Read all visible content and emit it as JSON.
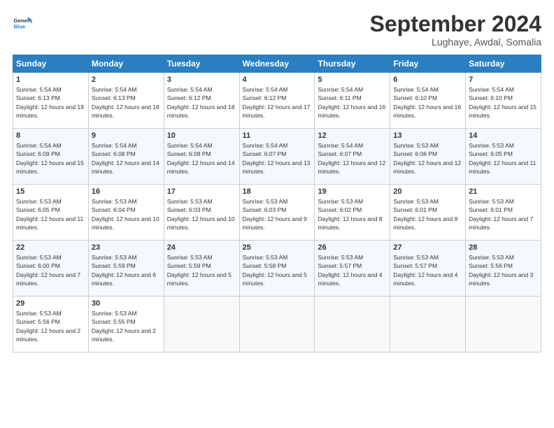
{
  "header": {
    "logo_line1": "General",
    "logo_line2": "Blue",
    "month": "September 2024",
    "location": "Lughaye, Awdal, Somalia"
  },
  "weekdays": [
    "Sunday",
    "Monday",
    "Tuesday",
    "Wednesday",
    "Thursday",
    "Friday",
    "Saturday"
  ],
  "weeks": [
    [
      {
        "day": "1",
        "rise": "5:54 AM",
        "set": "6:13 PM",
        "hours": "12 hours and 19 minutes."
      },
      {
        "day": "2",
        "rise": "5:54 AM",
        "set": "6:13 PM",
        "hours": "12 hours and 18 minutes."
      },
      {
        "day": "3",
        "rise": "5:54 AM",
        "set": "6:12 PM",
        "hours": "12 hours and 18 minutes."
      },
      {
        "day": "4",
        "rise": "5:54 AM",
        "set": "6:12 PM",
        "hours": "12 hours and 17 minutes."
      },
      {
        "day": "5",
        "rise": "5:54 AM",
        "set": "6:11 PM",
        "hours": "12 hours and 16 minutes."
      },
      {
        "day": "6",
        "rise": "5:54 AM",
        "set": "6:10 PM",
        "hours": "12 hours and 16 minutes."
      },
      {
        "day": "7",
        "rise": "5:54 AM",
        "set": "6:10 PM",
        "hours": "12 hours and 15 minutes."
      }
    ],
    [
      {
        "day": "8",
        "rise": "5:54 AM",
        "set": "6:09 PM",
        "hours": "12 hours and 15 minutes."
      },
      {
        "day": "9",
        "rise": "5:54 AM",
        "set": "6:08 PM",
        "hours": "12 hours and 14 minutes."
      },
      {
        "day": "10",
        "rise": "5:54 AM",
        "set": "6:08 PM",
        "hours": "12 hours and 14 minutes."
      },
      {
        "day": "11",
        "rise": "5:54 AM",
        "set": "6:07 PM",
        "hours": "12 hours and 13 minutes."
      },
      {
        "day": "12",
        "rise": "5:54 AM",
        "set": "6:07 PM",
        "hours": "12 hours and 12 minutes."
      },
      {
        "day": "13",
        "rise": "5:53 AM",
        "set": "6:06 PM",
        "hours": "12 hours and 12 minutes."
      },
      {
        "day": "14",
        "rise": "5:53 AM",
        "set": "6:05 PM",
        "hours": "12 hours and 11 minutes."
      }
    ],
    [
      {
        "day": "15",
        "rise": "5:53 AM",
        "set": "6:05 PM",
        "hours": "12 hours and 11 minutes."
      },
      {
        "day": "16",
        "rise": "5:53 AM",
        "set": "6:04 PM",
        "hours": "12 hours and 10 minutes."
      },
      {
        "day": "17",
        "rise": "5:53 AM",
        "set": "6:03 PM",
        "hours": "12 hours and 10 minutes."
      },
      {
        "day": "18",
        "rise": "5:53 AM",
        "set": "6:03 PM",
        "hours": "12 hours and 9 minutes."
      },
      {
        "day": "19",
        "rise": "5:53 AM",
        "set": "6:02 PM",
        "hours": "12 hours and 8 minutes."
      },
      {
        "day": "20",
        "rise": "5:53 AM",
        "set": "6:01 PM",
        "hours": "12 hours and 8 minutes."
      },
      {
        "day": "21",
        "rise": "5:53 AM",
        "set": "6:01 PM",
        "hours": "12 hours and 7 minutes."
      }
    ],
    [
      {
        "day": "22",
        "rise": "5:53 AM",
        "set": "6:00 PM",
        "hours": "12 hours and 7 minutes."
      },
      {
        "day": "23",
        "rise": "5:53 AM",
        "set": "5:59 PM",
        "hours": "12 hours and 6 minutes."
      },
      {
        "day": "24",
        "rise": "5:53 AM",
        "set": "5:59 PM",
        "hours": "12 hours and 5 minutes."
      },
      {
        "day": "25",
        "rise": "5:53 AM",
        "set": "5:58 PM",
        "hours": "12 hours and 5 minutes."
      },
      {
        "day": "26",
        "rise": "5:53 AM",
        "set": "5:57 PM",
        "hours": "12 hours and 4 minutes."
      },
      {
        "day": "27",
        "rise": "5:53 AM",
        "set": "5:57 PM",
        "hours": "12 hours and 4 minutes."
      },
      {
        "day": "28",
        "rise": "5:53 AM",
        "set": "5:56 PM",
        "hours": "12 hours and 3 minutes."
      }
    ],
    [
      {
        "day": "29",
        "rise": "5:53 AM",
        "set": "5:56 PM",
        "hours": "12 hours and 2 minutes."
      },
      {
        "day": "30",
        "rise": "5:53 AM",
        "set": "5:55 PM",
        "hours": "12 hours and 2 minutes."
      },
      null,
      null,
      null,
      null,
      null
    ]
  ],
  "labels": {
    "sunrise": "Sunrise:",
    "sunset": "Sunset:",
    "daylight": "Daylight:"
  }
}
